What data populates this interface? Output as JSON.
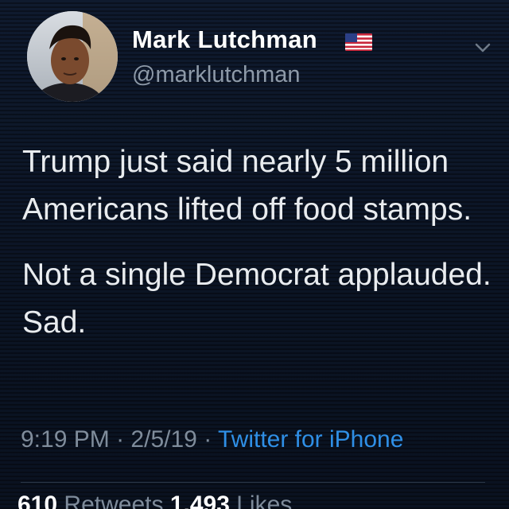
{
  "user": {
    "display_name": "Mark Lutchman",
    "handle": "@marklutchman",
    "flag_icon": "us-flag-icon",
    "avatar_icon": "avatar-photo"
  },
  "tweet": {
    "paragraphs": [
      "Trump just said nearly 5 million Americans lifted off food stamps.",
      "Not a single Democrat applauded. Sad."
    ],
    "time": "9:19 PM",
    "date": "2/5/19",
    "separator": "·",
    "source": "Twitter for iPhone"
  },
  "stats": {
    "retweets_count": "610",
    "retweets_label": "Retweets",
    "likes_count": "1,493",
    "likes_label": "Likes"
  },
  "colors": {
    "background": "#0b1424",
    "link": "#2f8fe6",
    "muted": "#7f8c9b",
    "text": "#e9ecef"
  }
}
